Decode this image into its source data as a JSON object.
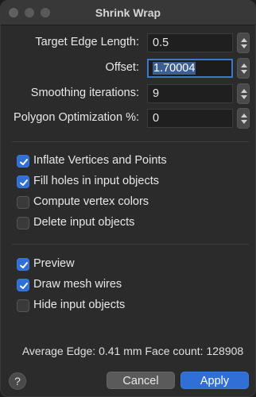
{
  "window": {
    "title": "Shrink Wrap"
  },
  "fields": {
    "target_edge_length": {
      "label": "Target Edge Length:",
      "value": "0.5"
    },
    "offset": {
      "label": "Offset:",
      "value": "1.70004"
    },
    "smoothing_iterations": {
      "label": "Smoothing iterations:",
      "value": "9"
    },
    "polygon_optimization": {
      "label": "Polygon Optimization %:",
      "value": "0"
    }
  },
  "options_group_1": [
    {
      "label": "Inflate Vertices and Points",
      "checked": true
    },
    {
      "label": "Fill holes in input objects",
      "checked": true
    },
    {
      "label": "Compute vertex colors",
      "checked": false
    },
    {
      "label": "Delete input objects",
      "checked": false
    }
  ],
  "options_group_2": [
    {
      "label": "Preview",
      "checked": true
    },
    {
      "label": "Draw mesh wires",
      "checked": true
    },
    {
      "label": "Hide input objects",
      "checked": false
    }
  ],
  "status": {
    "text": "Average Edge: 0.41 mm Face count: 128908"
  },
  "buttons": {
    "help": "?",
    "cancel": "Cancel",
    "apply": "Apply"
  },
  "colors": {
    "accent": "#2f6fd6",
    "focus_ring": "#3c78c8"
  }
}
